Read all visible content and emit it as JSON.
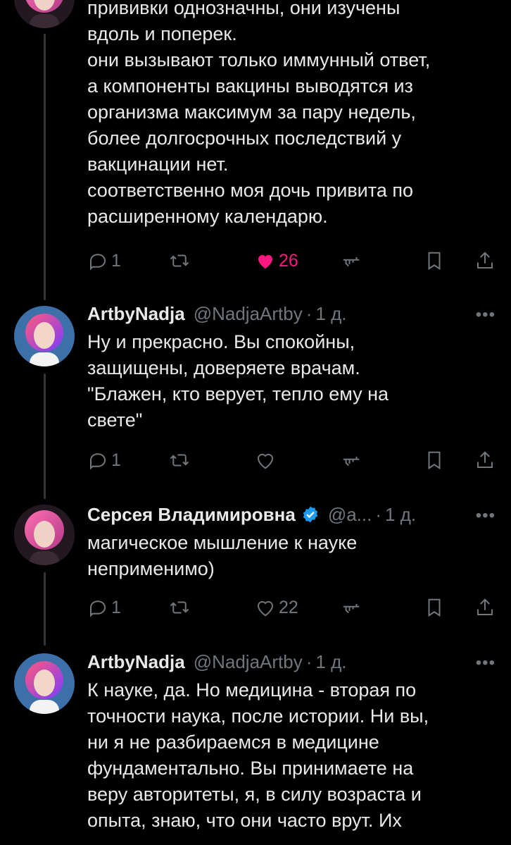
{
  "tweets": [
    {
      "text_lines": [
        "прививки однозначны, они изучены",
        "вдоль и поперек.",
        "они вызывают только иммунный ответ,",
        "а компоненты вакцины выводятся из",
        "организма максимум за пару недель,",
        "более долгосрочных последствий у",
        "вакцинации нет.",
        "соответственно моя дочь привита по",
        "расширенному календарю."
      ],
      "replies": "1",
      "retweets": "",
      "likes": "26",
      "liked": true
    },
    {
      "author": "ArtbyNadja",
      "handle": "@NadjaArtby",
      "time": "1 д.",
      "text_lines": [
        "Ну и прекрасно. Вы спокойны,",
        "защищены, доверяете врачам.",
        "\"Блажен, кто верует, тепло ему на",
        "свете\""
      ],
      "replies": "1",
      "retweets": "",
      "likes": "",
      "liked": false
    },
    {
      "author": "Серсея Владимировна",
      "handle": "@a...",
      "time": "1 д.",
      "verified": true,
      "text_lines": [
        "магическое мышление к науке",
        "неприменимо)"
      ],
      "replies": "1",
      "retweets": "",
      "likes": "22",
      "liked": false
    },
    {
      "author": "ArtbyNadja",
      "handle": "@NadjaArtby",
      "time": "1 д.",
      "text_lines": [
        "К науке, да. Но медицина - вторая по",
        "точности наука, после истории. Ни вы,",
        "ни я не разбираемся в медицине",
        "фундаментально. Вы принимаете на",
        "веру авторитеты, я, в силу возраста и",
        "опыта, знаю, что они часто врут. Их"
      ]
    }
  ],
  "ui": {
    "dot": "·",
    "more": "•••"
  },
  "colors": {
    "like_active": "#f91880",
    "muted": "#71767b",
    "verified": "#1d9bf0"
  }
}
